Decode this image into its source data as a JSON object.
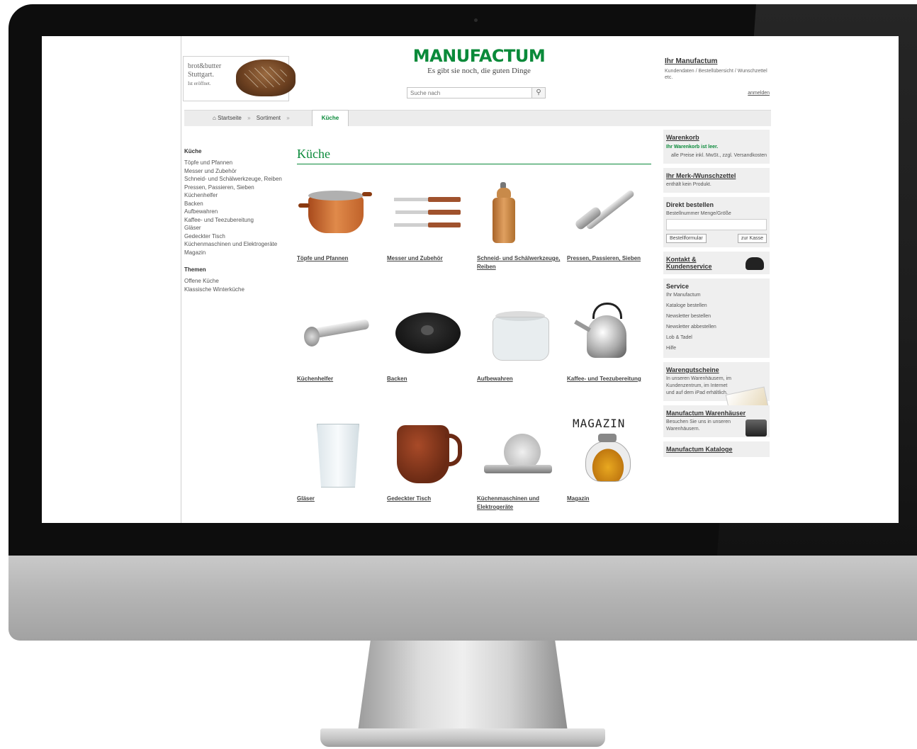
{
  "header": {
    "ad": {
      "line1": "brot&butter",
      "line2": "Stuttgart.",
      "line3": "Ist eröffnet."
    },
    "logo": {
      "mark": "MANUFACTUM",
      "tagline": "Es gibt sie noch, die guten Dinge"
    },
    "search": {
      "placeholder": "Suche nach"
    },
    "account": {
      "title": "Ihr Manufactum",
      "description": "Kundendaten / Bestellübersicht / Wunschzettel etc.",
      "login": "anmelden"
    }
  },
  "breadcrumb": {
    "home": "Startseite",
    "sortiment": "Sortiment",
    "current": "Küche"
  },
  "left_nav": {
    "heading": "Küche",
    "items": [
      "Töpfe und Pfannen",
      "Messer und Zubehör",
      "Schneid- und Schälwerkzeuge, Reiben",
      "Pressen, Passieren, Sieben",
      "Küchenhelfer",
      "Backen",
      "Aufbewahren",
      "Kaffee- und Teezubereitung",
      "Gläser",
      "Gedeckter Tisch",
      "Küchenmaschinen und Elektrogeräte",
      "Magazin"
    ],
    "themes_heading": "Themen",
    "themes": [
      "Offene Küche",
      "Klassische Winterküche"
    ]
  },
  "main": {
    "title": "Küche",
    "products": [
      "Töpfe und Pfannen",
      "Messer und Zubehör",
      "Schneid- und Schälwerkzeuge, Reiben",
      "Pressen, Passieren, Sieben",
      "Küchenhelfer",
      "Backen",
      "Aufbewahren",
      "Kaffee- und Teezubereitung",
      "Gläser",
      "Gedeckter Tisch",
      "Küchenmaschinen und Elektrogeräte",
      "Magazin"
    ],
    "magazin_logo": "MAGAZIN"
  },
  "right": {
    "cart": {
      "title": "Warenkorb",
      "empty": "Ihr Warenkorb ist leer.",
      "note": "alle Preise inkl. MwSt., zzgl. Versandkosten"
    },
    "wishlist": {
      "title": "Ihr Merk-/Wunschzettel",
      "text": "enthält kein Produkt."
    },
    "direct": {
      "title": "Direkt bestellen",
      "cols": "Bestellnummer  Menge/Größe",
      "button1": "Bestellformular",
      "button2": "zur Kasse"
    },
    "contact": {
      "title": "Kontakt & Kundenservice"
    },
    "service": {
      "title": "Service",
      "items": [
        "Ihr Manufactum",
        "Kataloge bestellen",
        "Newsletter bestellen",
        "Newsletter abbestellen",
        "Lob & Tadel",
        "Hilfe"
      ]
    },
    "vouchers": {
      "title": "Warengutscheine",
      "text": "In unseren Warenhäusern, im Kundenzentrum, im Internet und auf dem iPad erhältlich."
    },
    "stores": {
      "title": "Manufactum Warenhäuser",
      "text": "Besuchen Sie uns in unseren Warenhäusern."
    },
    "catalogs": {
      "title": "Manufactum Kataloge"
    }
  },
  "colors": {
    "brand_green": "#0a8a3a",
    "bezel": "#0d0d0d",
    "chin": "#b5b5b5"
  }
}
